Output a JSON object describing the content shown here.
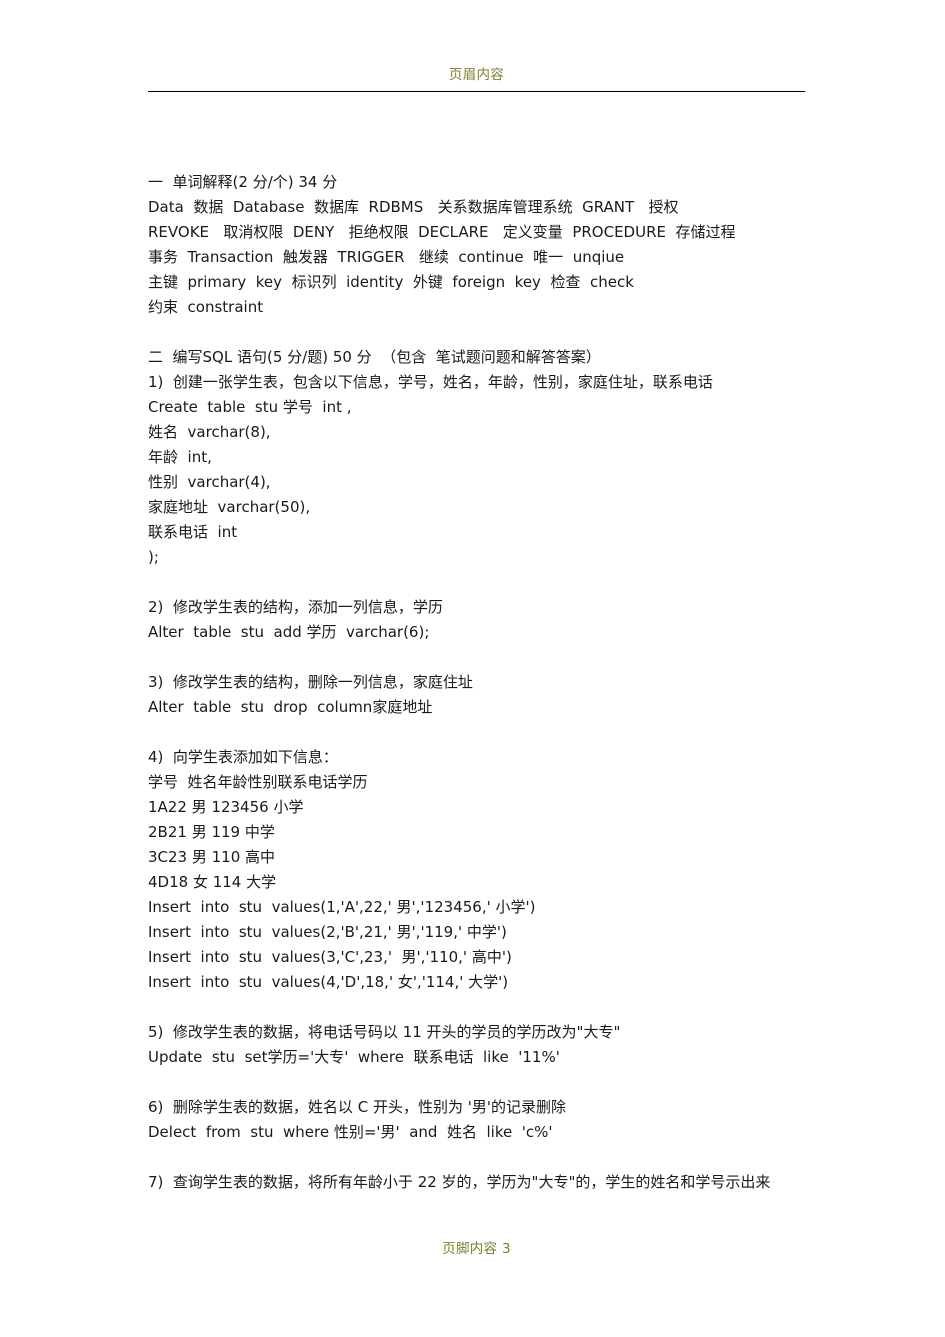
{
  "header": {
    "text": "页眉内容"
  },
  "footer": {
    "text": "页脚内容 3"
  },
  "document": {
    "sections": [
      {
        "id": "section-one",
        "heading": "一  单词解释(2 分/个) 34 分",
        "lines": [
          "Data  数据  Database  数据库  RDBMS   关系数据库管理系统  GRANT   授权",
          "REVOKE   取消权限  DENY   拒绝权限  DECLARE   定义变量  PROCEDURE  存储过程",
          "事务  Transaction  触发器  TRIGGER   继续  continue  唯一  unqiue",
          "主键  primary  key  标识列  identity  外键  foreign  key  检查  check",
          "约束  constraint"
        ]
      },
      {
        "id": "section-two",
        "heading": "二  编写SQL 语句(5 分/题) 50 分  （包含  笔试题问题和解答答案）",
        "items": [
          {
            "number": "1)",
            "prompt": "1)  创建一张学生表，包含以下信息，学号，姓名，年龄，性别，家庭住址，联系电话",
            "answer": [
              "Create  table  stu 学号  int ,",
              "姓名  varchar(8),",
              "年龄  int,",
              "性别  varchar(4),",
              "家庭地址  varchar(50),",
              "联系电话  int",
              ");"
            ]
          },
          {
            "number": "2)",
            "prompt": "2)  修改学生表的结构，添加一列信息，学历",
            "answer": [
              "Alter  table  stu  add 学历  varchar(6);"
            ]
          },
          {
            "number": "3)",
            "prompt": "3)  修改学生表的结构，删除一列信息，家庭住址",
            "answer": [
              "Alter  table  stu  drop  column家庭地址"
            ]
          },
          {
            "number": "4)",
            "prompt": "4)  向学生表添加如下信息：",
            "table_header": "学号  姓名年龄性别联系电话学历",
            "table_rows": [
              "1A22 男 123456 小学",
              "2B21 男 119 中学",
              "3C23 男 110 高中",
              "4D18 女 114 大学"
            ],
            "answer": [
              "Insert  into  stu  values(1,'A',22,' 男','123456,' 小学')",
              "Insert  into  stu  values(2,'B',21,' 男','119,' 中学')",
              "Insert  into  stu  values(3,'C',23,'  男','110,' 高中')",
              "Insert  into  stu  values(4,'D',18,' 女','114,' 大学')"
            ]
          },
          {
            "number": "5)",
            "prompt": "5)  修改学生表的数据，将电话号码以 11 开头的学员的学历改为\"大专\"",
            "answer": [
              "Update  stu  set学历='大专'  where  联系电话  like  '11%'"
            ]
          },
          {
            "number": "6)",
            "prompt": "6)  删除学生表的数据，姓名以 C 开头，性别为 '男'的记录删除",
            "answer": [
              "Delect  from  stu  where 性别='男'  and  姓名  like  'c%'"
            ]
          },
          {
            "number": "7)",
            "prompt": "7)  查询学生表的数据，将所有年龄小于 22 岁的，学历为\"大专\"的，学生的姓名和学号示出来",
            "answer": []
          }
        ]
      }
    ]
  }
}
